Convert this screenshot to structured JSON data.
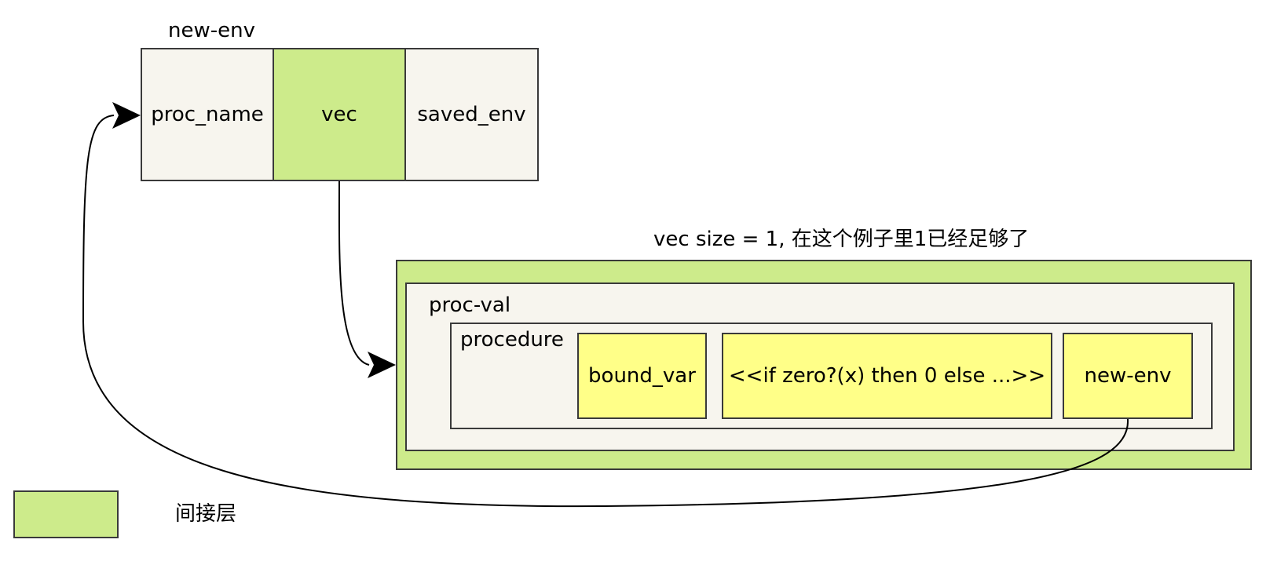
{
  "colors": {
    "cream": "#f7f5ee",
    "indirection_green": "#cdeb8b",
    "yellow": "#ffff88",
    "stroke": "#3a3a3a"
  },
  "new_env_struct": {
    "title": "new-env",
    "cells": [
      "proc_name",
      "vec",
      "saved_env"
    ]
  },
  "vec_box": {
    "caption": "vec size = 1, 在这个例子里1已经足够了",
    "proc_val_label": "proc-val",
    "procedure_label": "procedure",
    "fields": [
      "bound_var",
      "<<if zero?(x) then 0 else ...>>",
      "new-env"
    ]
  },
  "legend": {
    "label": "间接层"
  }
}
